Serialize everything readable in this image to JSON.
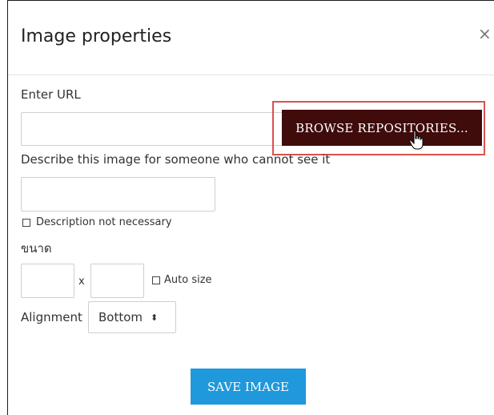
{
  "dialog": {
    "title": "Image properties",
    "close_glyph": "×"
  },
  "url": {
    "label": "Enter URL",
    "value": "",
    "browse_label": "BROWSE REPOSITORIES..."
  },
  "description": {
    "label": "Describe this image for someone who cannot see it",
    "value": "",
    "not_necessary_label": "Description not necessary",
    "not_necessary_checked": false
  },
  "size": {
    "label": "ขนาด",
    "width": "",
    "height": "",
    "separator": "x",
    "auto_size_label": "Auto size",
    "auto_size_checked": false
  },
  "alignment": {
    "label": "Alignment",
    "selected": "Bottom",
    "caret": "⬍"
  },
  "actions": {
    "save_label": "SAVE IMAGE"
  },
  "colors": {
    "browse_button": "#3f0b0b",
    "highlight_border": "#d9534f",
    "save_button": "#1f98dc"
  }
}
